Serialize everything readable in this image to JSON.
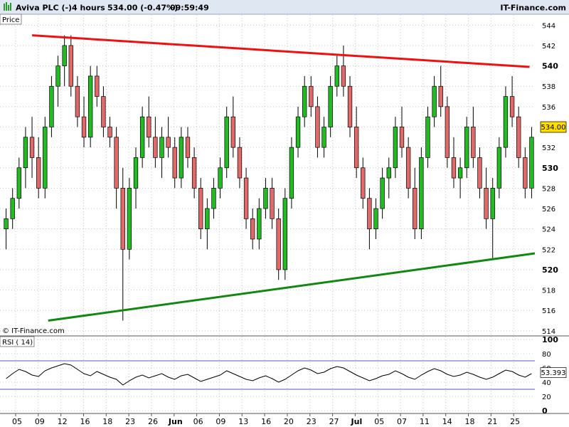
{
  "header": {
    "instrument": "Aviva PLC (-)",
    "timeframe": "4 hours",
    "quote": "534.00 (-0.47%)",
    "time": "09:59:49",
    "brand": "IT-Finance.com",
    "price_label": "Price",
    "watermark": "© IT-Finance.com",
    "rsi_label": "RSI ( 14)"
  },
  "colors": {
    "up_candle": "#22bb22",
    "down_candle": "#e06a6a",
    "resistance_line": "#ee1111",
    "support_line": "#118811",
    "rsi_band": "#5555bb",
    "current_price_badge": "#ffdd00"
  },
  "chart_data": [
    {
      "type": "candlestick",
      "ylim": [
        513.5,
        545
      ],
      "y_ticks": [
        514,
        516,
        518,
        520,
        522,
        524,
        526,
        528,
        530,
        532,
        534,
        536,
        538,
        540,
        542,
        544
      ],
      "y_ticks_bold": [
        520,
        530,
        540
      ],
      "x_tick_labels": [
        "05",
        "09",
        "12",
        "16",
        "18",
        "23",
        "26",
        "Jun",
        "06",
        "09",
        "13",
        "16",
        "20",
        "23",
        "27",
        "Jul",
        "05",
        "07",
        "11",
        "14",
        "18",
        "21",
        "25"
      ],
      "x_tick_labels_bold": [
        "Jun",
        "Jul"
      ],
      "current_price": "534.00",
      "ohlc": [
        [
          524,
          526,
          522,
          525
        ],
        [
          525,
          528,
          524,
          527
        ],
        [
          527,
          531,
          526,
          530
        ],
        [
          530,
          534,
          528,
          533
        ],
        [
          533,
          535,
          529,
          531
        ],
        [
          531,
          533,
          527,
          528
        ],
        [
          528,
          535,
          527,
          534
        ],
        [
          534,
          539,
          533,
          538
        ],
        [
          538,
          541,
          536,
          540
        ],
        [
          540,
          543,
          538,
          542
        ],
        [
          542,
          543,
          537,
          538
        ],
        [
          538,
          539,
          534,
          535
        ],
        [
          535,
          537,
          532,
          533
        ],
        [
          533,
          540,
          532,
          539
        ],
        [
          539,
          540,
          536,
          537
        ],
        [
          537,
          538,
          533,
          534
        ],
        [
          534,
          535,
          532,
          533
        ],
        [
          533,
          534,
          526,
          528
        ],
        [
          528,
          530,
          515,
          522
        ],
        [
          522,
          529,
          521,
          528
        ],
        [
          528,
          532,
          526,
          531
        ],
        [
          531,
          536,
          530,
          535
        ],
        [
          535,
          537,
          532,
          533
        ],
        [
          533,
          535,
          530,
          531
        ],
        [
          531,
          534,
          529,
          533
        ],
        [
          533,
          535,
          531,
          532
        ],
        [
          532,
          533,
          528,
          529
        ],
        [
          529,
          534,
          528,
          533
        ],
        [
          533,
          534,
          530,
          531
        ],
        [
          531,
          532,
          527,
          528
        ],
        [
          528,
          529,
          523,
          524
        ],
        [
          524,
          527,
          522,
          526
        ],
        [
          526,
          529,
          525,
          528
        ],
        [
          528,
          531,
          527,
          530
        ],
        [
          530,
          536,
          529,
          535
        ],
        [
          535,
          537,
          531,
          532
        ],
        [
          532,
          533,
          528,
          529
        ],
        [
          529,
          530,
          524,
          525
        ],
        [
          525,
          526,
          522,
          523
        ],
        [
          523,
          527,
          522,
          526
        ],
        [
          526,
          529,
          525,
          528
        ],
        [
          528,
          529,
          524,
          525
        ],
        [
          525,
          526,
          519,
          520
        ],
        [
          520,
          528,
          519,
          527
        ],
        [
          527,
          533,
          526,
          532
        ],
        [
          532,
          536,
          531,
          535
        ],
        [
          535,
          539,
          534,
          538
        ],
        [
          538,
          539,
          535,
          536
        ],
        [
          536,
          537,
          531,
          532
        ],
        [
          532,
          535,
          531,
          534
        ],
        [
          534,
          539,
          533,
          538
        ],
        [
          538,
          541,
          537,
          540
        ],
        [
          540,
          542,
          537,
          538
        ],
        [
          538,
          539,
          533,
          534
        ],
        [
          534,
          536,
          529,
          530
        ],
        [
          530,
          531,
          526,
          527
        ],
        [
          527,
          528,
          522,
          524
        ],
        [
          524,
          527,
          523,
          526
        ],
        [
          526,
          530,
          525,
          529
        ],
        [
          529,
          531,
          527,
          530
        ],
        [
          530,
          535,
          529,
          534
        ],
        [
          534,
          536,
          531,
          532
        ],
        [
          532,
          533,
          527,
          528
        ],
        [
          528,
          530,
          523,
          524
        ],
        [
          524,
          532,
          523,
          531
        ],
        [
          531,
          536,
          530,
          535
        ],
        [
          535,
          539,
          534,
          538
        ],
        [
          538,
          540,
          535,
          536
        ],
        [
          536,
          537,
          530,
          531
        ],
        [
          531,
          533,
          528,
          529
        ],
        [
          529,
          531,
          527,
          530
        ],
        [
          530,
          535,
          529,
          534
        ],
        [
          534,
          536,
          530,
          531
        ],
        [
          531,
          532,
          527,
          528
        ],
        [
          528,
          530,
          524,
          525
        ],
        [
          525,
          529,
          521,
          528
        ],
        [
          528,
          533,
          527,
          532
        ],
        [
          532,
          538,
          531,
          537
        ],
        [
          537,
          539,
          534,
          535
        ],
        [
          535,
          536,
          530,
          531
        ],
        [
          531,
          532,
          527,
          528
        ],
        [
          528,
          534,
          527,
          533
        ]
      ],
      "upper_trendline": {
        "from": [
          0.06,
          543.0
        ],
        "to": [
          0.99,
          539.9
        ]
      },
      "lower_trendline": {
        "from": [
          0.09,
          515.0
        ],
        "to": [
          1.0,
          521.6
        ]
      }
    },
    {
      "type": "line",
      "name": "RSI ( 14)",
      "ylim": [
        0,
        100
      ],
      "y_ticks": [
        0,
        20,
        40,
        60,
        80,
        100
      ],
      "bands": [
        30,
        70
      ],
      "last_value": "53.393",
      "values": [
        45,
        52,
        58,
        55,
        50,
        48,
        56,
        60,
        63,
        66,
        64,
        58,
        52,
        49,
        55,
        51,
        47,
        44,
        36,
        42,
        47,
        50,
        46,
        49,
        52,
        47,
        44,
        49,
        51,
        46,
        41,
        44,
        47,
        50,
        56,
        52,
        48,
        44,
        42,
        46,
        49,
        45,
        40,
        44,
        50,
        56,
        60,
        57,
        52,
        54,
        59,
        62,
        60,
        55,
        50,
        46,
        42,
        45,
        49,
        51,
        56,
        52,
        47,
        44,
        50,
        55,
        59,
        56,
        51,
        48,
        50,
        54,
        51,
        47,
        44,
        47,
        52,
        57,
        55,
        50,
        47,
        52
      ]
    }
  ]
}
